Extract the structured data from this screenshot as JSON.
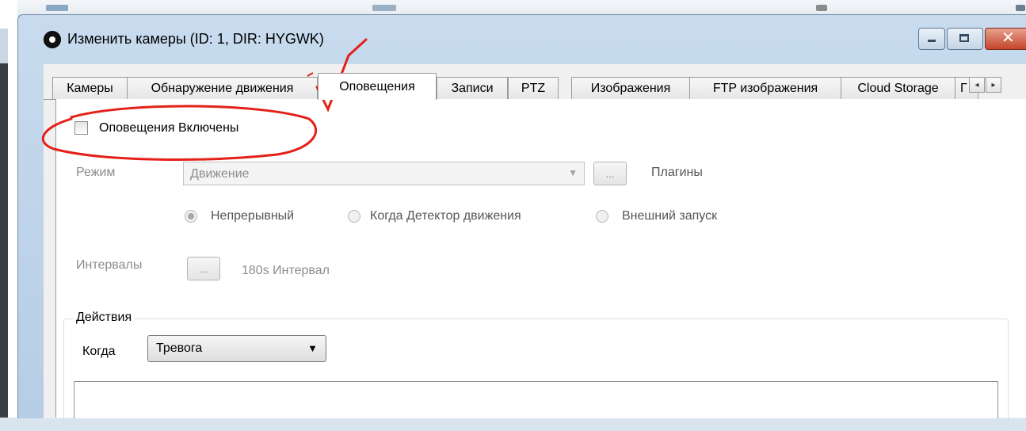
{
  "window": {
    "title": "Изменить камеры (ID: 1, DIR: HYGWK)",
    "close_glyph": "✕"
  },
  "tabs": [
    {
      "label": "Камеры"
    },
    {
      "label": "Обнаружение движения"
    },
    {
      "label": "Оповещения"
    },
    {
      "label": "Записи"
    },
    {
      "label": "PTZ"
    },
    {
      "label": "Изображения"
    },
    {
      "label": "FTP изображения"
    },
    {
      "label": "Cloud Storage"
    },
    {
      "label": "Г"
    }
  ],
  "active_tab": "Оповещения",
  "alerts": {
    "enabled_label": "Оповещения Включены",
    "enabled_checked": false,
    "mode_label": "Режим",
    "mode_value": "Движение",
    "plugins_button": "...",
    "plugins_label": "Плагины",
    "radio_options": [
      "Непрерывный",
      "Когда Детектор движения",
      "Внешний запуск"
    ],
    "radio_selected": "Непрерывный",
    "intervals_label": "Интервалы",
    "intervals_button": "...",
    "intervals_value": "180s Интервал"
  },
  "actions": {
    "legend": "Действия",
    "when_label": "Когда",
    "when_value": "Тревога"
  },
  "colors": {
    "annotation": "#e32119",
    "disabled_text": "#8c8c8c"
  }
}
